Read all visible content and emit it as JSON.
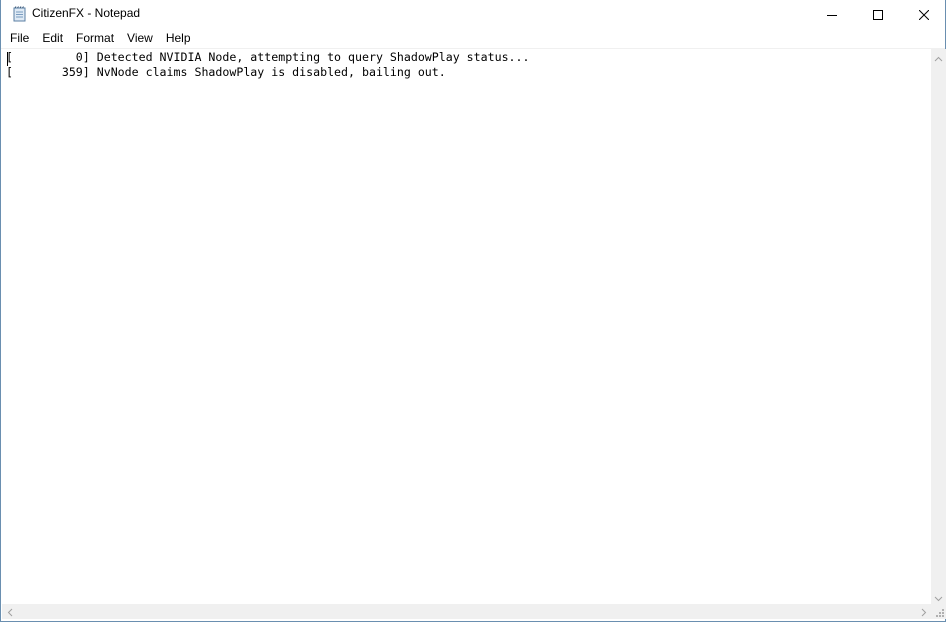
{
  "window": {
    "title": "CitizenFX - Notepad",
    "app_icon": "notepad-icon"
  },
  "caption_buttons": {
    "minimize_icon": "minimize-icon",
    "maximize_icon": "maximize-icon",
    "close_icon": "close-icon"
  },
  "menu": {
    "items": [
      {
        "label": "File"
      },
      {
        "label": "Edit"
      },
      {
        "label": "Format"
      },
      {
        "label": "View"
      },
      {
        "label": "Help"
      }
    ]
  },
  "editor": {
    "lines": [
      "[         0] Detected NVIDIA Node, attempting to query ShadowPlay status...",
      "[       359] NvNode claims ShadowPlay is disabled, bailing out."
    ]
  },
  "colors": {
    "window_border": "#6a8fb0",
    "scrollbar_bg": "#f0f0f0",
    "arrow": "#a0a0a0"
  }
}
